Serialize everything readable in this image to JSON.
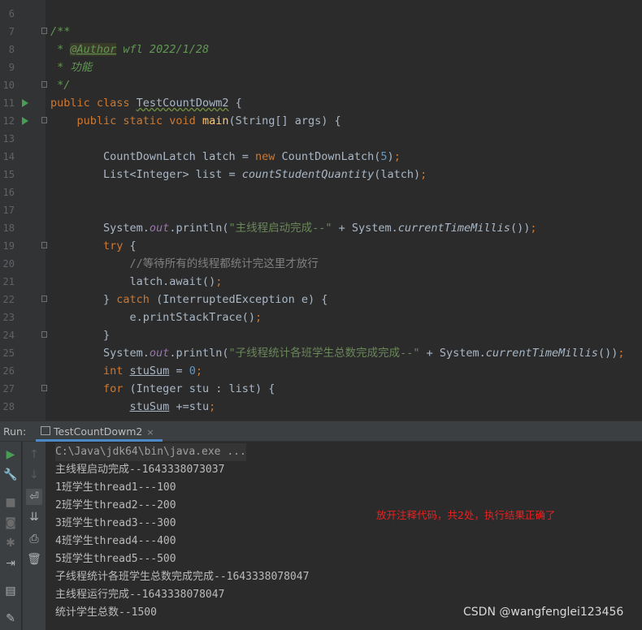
{
  "editor": {
    "lines": [
      {
        "n": "6",
        "tokens": []
      },
      {
        "n": "7",
        "tokens": [
          {
            "t": "/**",
            "c": "cmt"
          }
        ]
      },
      {
        "n": "8",
        "tokens": [
          {
            "t": " * ",
            "c": "cmt"
          },
          {
            "t": "@Author",
            "c": "tag"
          },
          {
            "t": " wfl 2022/1/28",
            "c": "cmt"
          }
        ]
      },
      {
        "n": "9",
        "tokens": [
          {
            "t": " * 功能",
            "c": "cmt"
          }
        ]
      },
      {
        "n": "10",
        "tokens": [
          {
            "t": " */",
            "c": "cmt"
          }
        ]
      },
      {
        "n": "11",
        "tokens": [
          {
            "t": "public class ",
            "c": "kw"
          },
          {
            "t": "TestCountDowm2",
            "c": "ann"
          },
          {
            "t": " {",
            "c": ""
          }
        ]
      },
      {
        "n": "12",
        "tokens": [
          {
            "t": "    public static void ",
            "c": "kw"
          },
          {
            "t": "main",
            "c": "fn"
          },
          {
            "t": "(String[] args) {",
            "c": ""
          }
        ]
      },
      {
        "n": "13",
        "tokens": []
      },
      {
        "n": "14",
        "tokens": [
          {
            "t": "        CountDownLatch latch = ",
            "c": ""
          },
          {
            "t": "new ",
            "c": "kw"
          },
          {
            "t": "CountDownLatch(",
            "c": ""
          },
          {
            "t": "5",
            "c": "num"
          },
          {
            "t": ")",
            "c": ""
          },
          {
            "t": ";",
            "c": "kw"
          }
        ]
      },
      {
        "n": "15",
        "tokens": [
          {
            "t": "        List<Integer> list = ",
            "c": ""
          },
          {
            "t": "countStudentQuantity",
            "c": "stm"
          },
          {
            "t": "(latch)",
            "c": ""
          },
          {
            "t": ";",
            "c": "kw"
          }
        ]
      },
      {
        "n": "16",
        "tokens": []
      },
      {
        "n": "17",
        "tokens": []
      },
      {
        "n": "18",
        "tokens": [
          {
            "t": "        System.",
            "c": ""
          },
          {
            "t": "out",
            "c": "st"
          },
          {
            "t": ".println(",
            "c": ""
          },
          {
            "t": "\"主线程启动完成--\"",
            "c": "str"
          },
          {
            "t": " + System.",
            "c": ""
          },
          {
            "t": "currentTimeMillis",
            "c": "stm"
          },
          {
            "t": "())",
            "c": ""
          },
          {
            "t": ";",
            "c": "kw"
          }
        ]
      },
      {
        "n": "19",
        "tokens": [
          {
            "t": "        try ",
            "c": "kw"
          },
          {
            "t": "{",
            "c": ""
          }
        ]
      },
      {
        "n": "20",
        "tokens": [
          {
            "t": "            //等待所有的线程都统计完这里才放行",
            "c": "lc"
          }
        ]
      },
      {
        "n": "21",
        "tokens": [
          {
            "t": "            latch.await()",
            "c": ""
          },
          {
            "t": ";",
            "c": "kw"
          }
        ]
      },
      {
        "n": "22",
        "tokens": [
          {
            "t": "        } ",
            "c": ""
          },
          {
            "t": "catch ",
            "c": "kw"
          },
          {
            "t": "(InterruptedException e) {",
            "c": ""
          }
        ]
      },
      {
        "n": "23",
        "tokens": [
          {
            "t": "            e.printStackTrace()",
            "c": ""
          },
          {
            "t": ";",
            "c": "kw"
          }
        ]
      },
      {
        "n": "24",
        "tokens": [
          {
            "t": "        }",
            "c": ""
          }
        ]
      },
      {
        "n": "25",
        "tokens": [
          {
            "t": "        System.",
            "c": ""
          },
          {
            "t": "out",
            "c": "st"
          },
          {
            "t": ".println(",
            "c": ""
          },
          {
            "t": "\"子线程统计各班学生总数完成完成--\"",
            "c": "str"
          },
          {
            "t": " + System.",
            "c": ""
          },
          {
            "t": "currentTimeMillis",
            "c": "stm"
          },
          {
            "t": "())",
            "c": ""
          },
          {
            "t": ";",
            "c": "kw"
          }
        ]
      },
      {
        "n": "26",
        "tokens": [
          {
            "t": "        int ",
            "c": "kw"
          },
          {
            "t": "stuSum",
            "c": "ul"
          },
          {
            "t": " = ",
            "c": ""
          },
          {
            "t": "0",
            "c": "num"
          },
          {
            "t": ";",
            "c": "kw"
          }
        ]
      },
      {
        "n": "27",
        "tokens": [
          {
            "t": "        for ",
            "c": "kw"
          },
          {
            "t": "(Integer stu : list) {",
            "c": ""
          }
        ]
      },
      {
        "n": "28",
        "tokens": [
          {
            "t": "            ",
            "c": ""
          },
          {
            "t": "stuSum",
            "c": "ul"
          },
          {
            "t": " +=stu",
            "c": ""
          },
          {
            "t": ";",
            "c": "kw"
          }
        ]
      }
    ]
  },
  "run_panel": {
    "label": "Run:",
    "tab_title": "TestCountDowm2",
    "tab_close": "×",
    "console_lines": [
      "C:\\Java\\jdk64\\bin\\java.exe ...",
      "主线程启动完成--1643338073037",
      "1班学生thread1---100",
      "2班学生thread2---200",
      "3班学生thread3---300",
      "4班学生thread4---400",
      "5班学生thread5---500",
      "子线程统计各班学生总数完成完成--1643338078047",
      "主线程运行完成--1643338078047",
      "统计学生总数--1500"
    ],
    "note": "放开注释代码，共2处，执行结果正确了",
    "watermark": "CSDN @wangfenglei123456"
  },
  "icons": {
    "run": "play-icon",
    "tools": "wrench-icon",
    "stop": "stop-icon",
    "camera": "camera-icon",
    "debug": "bug-icon",
    "login": "login-icon",
    "layout": "layout-icon",
    "pin": "pin-icon",
    "up": "arrow-up-icon",
    "down": "arrow-down-icon",
    "wrap": "soft-wrap-icon",
    "scroll": "scroll-to-end-icon",
    "print": "print-icon",
    "trash": "trash-icon"
  },
  "colors": {
    "keyword": "#cc7832",
    "string": "#6a8759",
    "comment": "#629755",
    "function": "#ffc66d",
    "static_field": "#9876aa",
    "number": "#6897bb",
    "note": "#ee1f1f",
    "run_marker": "#499c54"
  }
}
